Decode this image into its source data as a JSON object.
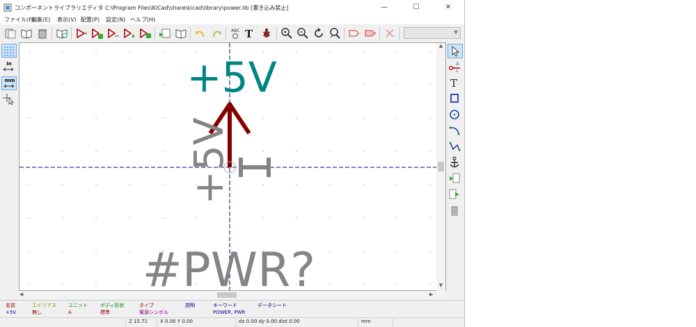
{
  "window": {
    "title": "コンポーネントライブラリエディタ C:\\Program Files\\KiCad\\share\\kicad\\library\\power.lib [書き込み禁止]",
    "minimize": "—",
    "maximize": "☐",
    "close": "✕"
  },
  "menu": [
    "ファイル(F)",
    "編集(E)",
    "表示(V)",
    "配置(P)",
    "設定(N)",
    "ヘルプ(H)"
  ],
  "toolbar": {
    "icons": [
      "new-library-icon",
      "open-library-icon",
      "delete-library-icon",
      "library-browser-icon",
      "new-part-icon",
      "save-part-icon",
      "import-part-icon",
      "export-part-icon",
      "create-lib-icon",
      "load-lib-icon",
      "show-datasheet-icon",
      "undo-icon",
      "redo-icon",
      "spellcheck-icon",
      "text-icon",
      "bug-icon",
      "zoom-in-icon",
      "zoom-out-icon",
      "zoom-redraw-icon",
      "zoom-fit-icon",
      "show-body-icon",
      "show-deMorgan-icon",
      "pdf-icon"
    ],
    "unit_select": ""
  },
  "left_toolbar": {
    "icons": [
      "grid-icon",
      "inch-units-icon",
      "mm-units-icon",
      "cursor-shape-icon"
    ],
    "inch_label": "In",
    "mm_label": "mm"
  },
  "right_toolbar": {
    "icons": [
      "select-arrow-icon",
      "add-pin-icon",
      "add-text-icon",
      "add-rectangle-icon",
      "add-circle-icon",
      "add-arc-icon",
      "add-polyline-icon",
      "anchor-icon",
      "import-graphic-icon",
      "export-graphic-icon",
      "delete-item-icon"
    ]
  },
  "canvas": {
    "value_text": "+5V",
    "reference_text": "#PWR?",
    "rotated_value_text": "+5V",
    "pin_number": "1",
    "colors": {
      "value": "#008484",
      "reference": "#848484",
      "body": "#840000",
      "axis": "#000084"
    }
  },
  "message_panel": {
    "columns": [
      {
        "header": "名前",
        "value": "+5V",
        "header_color": "#840000",
        "value_color": "#000084"
      },
      {
        "header": "エイリアス",
        "value": "無し",
        "header_color": "#848400",
        "value_color": "#840000"
      },
      {
        "header": "ユニット",
        "value": "A",
        "header_color": "#008400",
        "value_color": "#840000"
      },
      {
        "header": "ボディ形状",
        "value": "標準",
        "header_color": "#008400",
        "value_color": "#840000"
      },
      {
        "header": "タイプ",
        "value": "電源シンボル",
        "header_color": "#840000",
        "value_color": "#840084"
      },
      {
        "header": "説明",
        "value": "",
        "header_color": "#000084",
        "value_color": "#000084"
      },
      {
        "header": "キーワード",
        "value": "POWER, PWR",
        "header_color": "#000084",
        "value_color": "#000084"
      },
      {
        "header": "データシート",
        "value": "",
        "header_color": "#000084",
        "value_color": "#000084"
      }
    ]
  },
  "status_bar": {
    "zoom": "Z 15.71",
    "coords": "X 0.00  Y 0.00",
    "delta": "dx 0.00  dy 0.00  dist 0.00",
    "units": "mm"
  }
}
